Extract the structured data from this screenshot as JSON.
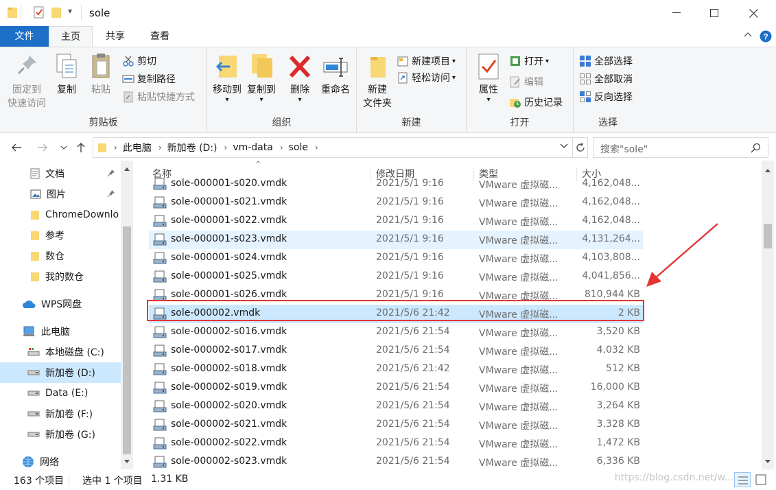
{
  "window": {
    "title": "sole",
    "qat_dropdown": "▾"
  },
  "tabs": {
    "file": "文件",
    "home": "主页",
    "share": "共享",
    "view": "查看"
  },
  "ribbon": {
    "clipboard": {
      "pin_label_1": "固定到",
      "pin_label_2": "快速访问",
      "copy": "复制",
      "paste": "粘贴",
      "cut": "剪切",
      "copy_path": "复制路径",
      "paste_shortcut": "粘贴快捷方式",
      "group": "剪贴板"
    },
    "organize": {
      "move_to": "移动到",
      "copy_to": "复制到",
      "delete": "删除",
      "rename": "重命名",
      "group": "组织"
    },
    "new": {
      "new_folder_1": "新建",
      "new_folder_2": "文件夹",
      "new_item": "新建项目",
      "easy_access": "轻松访问",
      "group": "新建"
    },
    "open": {
      "properties": "属性",
      "open": "打开",
      "edit": "编辑",
      "history": "历史记录",
      "group": "打开"
    },
    "select": {
      "select_all": "全部选择",
      "select_none": "全部取消",
      "invert": "反向选择",
      "group": "选择"
    }
  },
  "address": {
    "crumbs": [
      "此电脑",
      "新加卷 (D:)",
      "vm-data",
      "sole"
    ],
    "search_placeholder": "搜索\"sole\""
  },
  "nav": {
    "items": [
      {
        "label": "文档",
        "icon": "document-icon"
      },
      {
        "label": "图片",
        "icon": "picture-icon"
      },
      {
        "label": "ChromeDownlo",
        "icon": "folder-icon"
      },
      {
        "label": "参考",
        "icon": "folder-icon"
      },
      {
        "label": "数仓",
        "icon": "folder-icon"
      },
      {
        "label": "我的数仓",
        "icon": "folder-icon"
      },
      {
        "label": "WPS网盘",
        "icon": "cloud-icon"
      },
      {
        "label": "此电脑",
        "icon": "computer-icon"
      },
      {
        "label": "本地磁盘 (C:)",
        "icon": "drive-icon"
      },
      {
        "label": "新加卷 (D:)",
        "icon": "drive-icon"
      },
      {
        "label": "Data (E:)",
        "icon": "drive-icon"
      },
      {
        "label": "新加卷 (F:)",
        "icon": "drive-icon"
      },
      {
        "label": "新加卷 (G:)",
        "icon": "drive-icon"
      },
      {
        "label": "网络",
        "icon": "network-icon"
      }
    ]
  },
  "list": {
    "columns": {
      "name": "名称",
      "date": "修改日期",
      "type": "类型",
      "size": "大小"
    },
    "rows": [
      {
        "name": "sole-000001-s020.vmdk",
        "date": "2021/5/1 9:16",
        "type": "VMware 虚拟磁...",
        "size": "4,162,048..."
      },
      {
        "name": "sole-000001-s021.vmdk",
        "date": "2021/5/1 9:16",
        "type": "VMware 虚拟磁...",
        "size": "4,162,048..."
      },
      {
        "name": "sole-000001-s022.vmdk",
        "date": "2021/5/1 9:16",
        "type": "VMware 虚拟磁...",
        "size": "4,162,048..."
      },
      {
        "name": "sole-000001-s023.vmdk",
        "date": "2021/5/1 9:16",
        "type": "VMware 虚拟磁...",
        "size": "4,131,264..."
      },
      {
        "name": "sole-000001-s024.vmdk",
        "date": "2021/5/1 9:16",
        "type": "VMware 虚拟磁...",
        "size": "4,103,808..."
      },
      {
        "name": "sole-000001-s025.vmdk",
        "date": "2021/5/1 9:16",
        "type": "VMware 虚拟磁...",
        "size": "4,041,856..."
      },
      {
        "name": "sole-000001-s026.vmdk",
        "date": "2021/5/1 9:16",
        "type": "VMware 虚拟磁...",
        "size": "810,944 KB"
      },
      {
        "name": "sole-000002.vmdk",
        "date": "2021/5/6 21:42",
        "type": "VMware 虚拟磁...",
        "size": "2 KB"
      },
      {
        "name": "sole-000002-s016.vmdk",
        "date": "2021/5/6 21:54",
        "type": "VMware 虚拟磁...",
        "size": "3,520 KB"
      },
      {
        "name": "sole-000002-s017.vmdk",
        "date": "2021/5/6 21:54",
        "type": "VMware 虚拟磁...",
        "size": "4,032 KB"
      },
      {
        "name": "sole-000002-s018.vmdk",
        "date": "2021/5/6 21:42",
        "type": "VMware 虚拟磁...",
        "size": "512 KB"
      },
      {
        "name": "sole-000002-s019.vmdk",
        "date": "2021/5/6 21:54",
        "type": "VMware 虚拟磁...",
        "size": "16,000 KB"
      },
      {
        "name": "sole-000002-s020.vmdk",
        "date": "2021/5/6 21:54",
        "type": "VMware 虚拟磁...",
        "size": "3,264 KB"
      },
      {
        "name": "sole-000002-s021.vmdk",
        "date": "2021/5/6 21:54",
        "type": "VMware 虚拟磁...",
        "size": "3,328 KB"
      },
      {
        "name": "sole-000002-s022.vmdk",
        "date": "2021/5/6 21:54",
        "type": "VMware 虚拟磁...",
        "size": "1,472 KB"
      },
      {
        "name": "sole-000002-s023.vmdk",
        "date": "2021/5/6 21:54",
        "type": "VMware 虚拟磁...",
        "size": "6,336 KB"
      }
    ]
  },
  "status": {
    "count": "163 个项目",
    "selected": "选中 1 个项目",
    "selected_size": "1.31 KB",
    "watermark": "https://blog.csdn.net/w..."
  },
  "colors": {
    "accent": "#1e6fc7",
    "selection": "#cce8ff",
    "hover": "#e5f3ff",
    "annotation": "#e53333"
  }
}
